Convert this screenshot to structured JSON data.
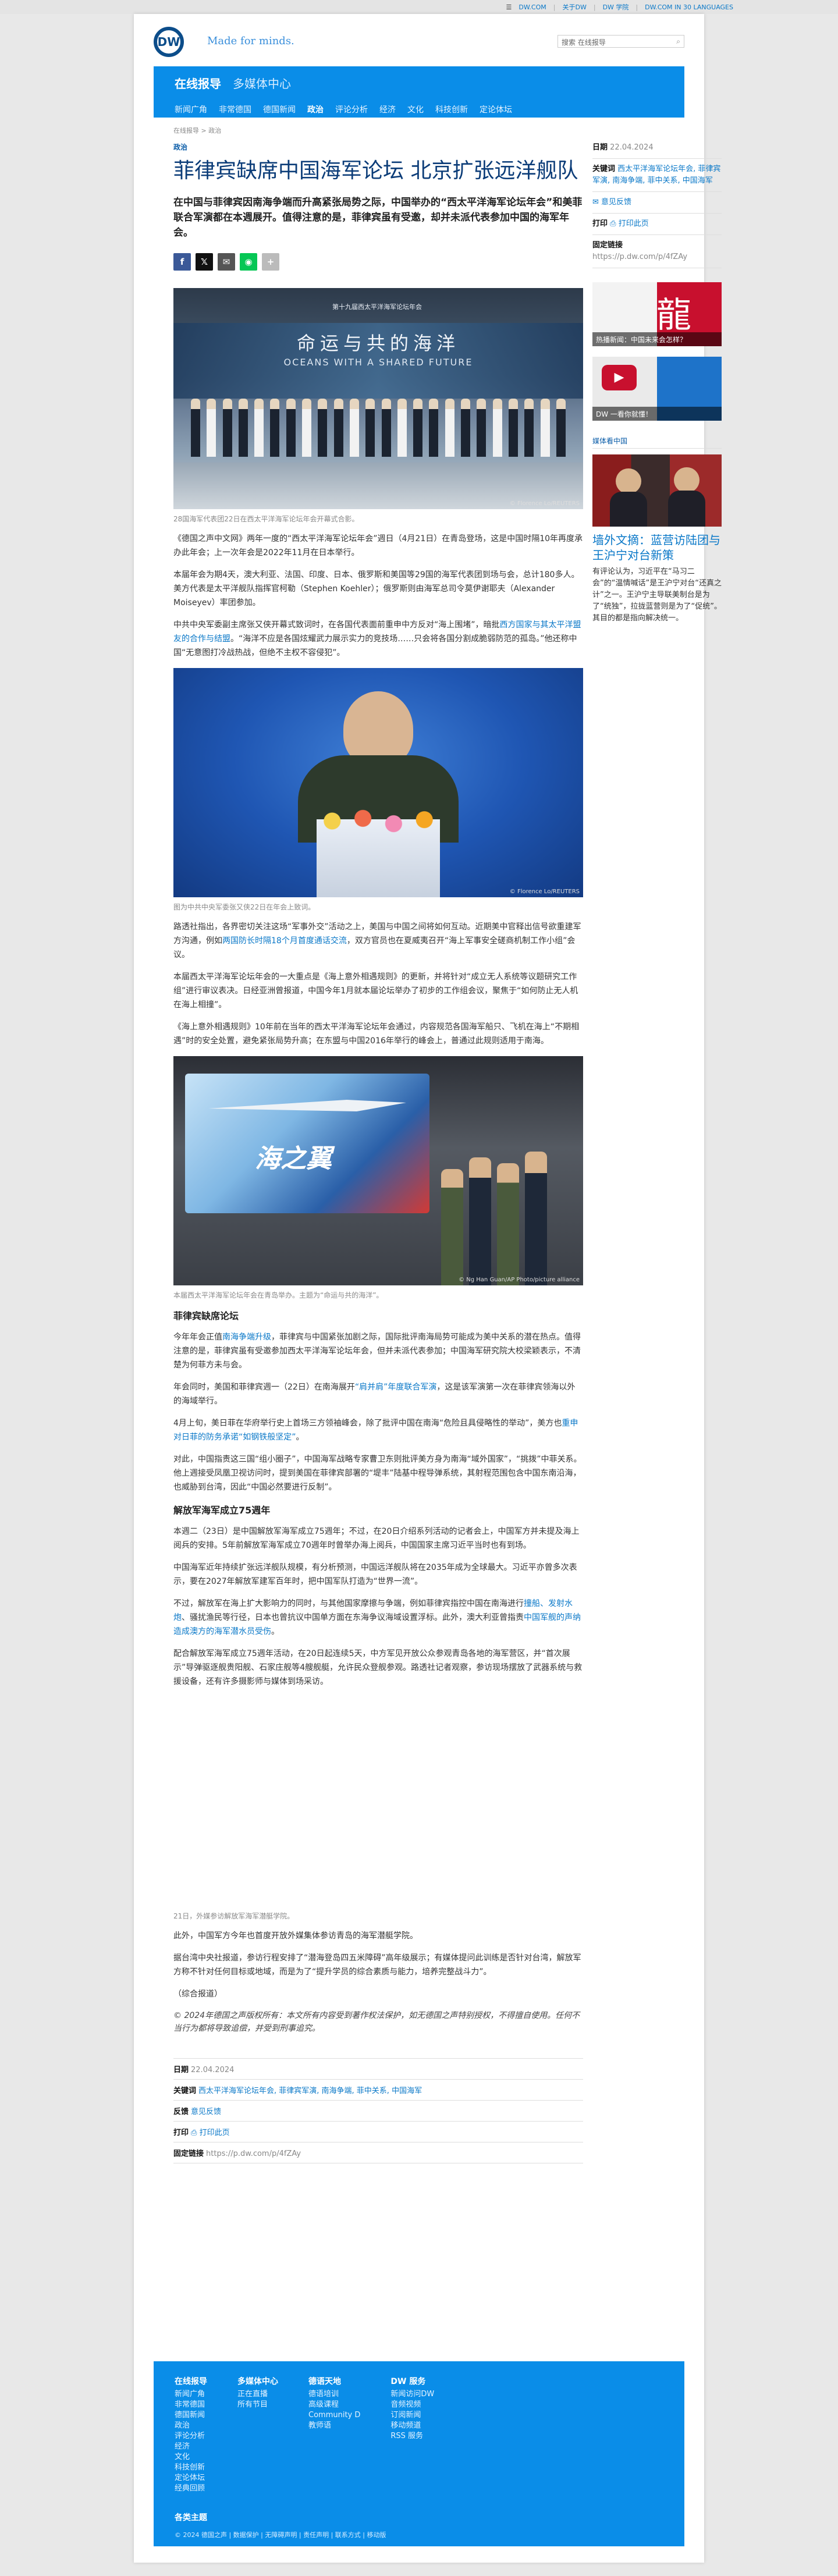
{
  "topbar": {
    "links": [
      "DW.COM",
      "关于DW",
      "DW 学院",
      "DW.COM IN 30 LANGUAGES"
    ]
  },
  "header": {
    "logo": "DW",
    "tagline": "Made for minds.",
    "search_placeholder": "搜索 在线报导"
  },
  "nav": {
    "title": "在线报导",
    "subtitle": "多媒体中心",
    "links": [
      "新闻广角",
      "非常德国",
      "德国新闻",
      "政治",
      "评论分析",
      "经济",
      "文化",
      "科技创新",
      "定论体坛"
    ],
    "active_index": 3
  },
  "breadcrumb": "在线报导 > 政治",
  "article": {
    "kicker": "政治",
    "title": "菲律宾缺席中国海军论坛 北京扩张远洋舰队",
    "lead": "在中国与菲律宾因南海争端而升高紧张局势之际，中国举办的“西太平洋海军论坛年会”和美菲联合军演都在本週展开。值得注意的是，菲律宾虽有受邀，却并未派代表参加中国的海军年会。",
    "share_icons": [
      "facebook-icon",
      "x-icon",
      "email-icon",
      "line-icon",
      "more-icon"
    ],
    "photo1_caption": "28国海军代表团22日在西太平洋海军论坛年会开幕式合影。",
    "photo1_banner_cn": "命运与共的海洋",
    "photo1_banner_en": "OCEANS WITH A SHARED FUTURE",
    "photo1_credit": "© Florence Lo/REUTERS",
    "p1": "《德国之声中文网》两年一度的“西太平洋海军论坛年会”週日（4月21日）在青岛登场，这是中国时隔10年再度承办此年会；上一次年会是2022年11月在日本举行。",
    "p2": "本届年会为期4天，澳大利亚、法国、印度、日本、俄罗斯和美国等29国的海军代表团到场与会，总计180多人。美方代表是太平洋舰队指挥官柯勒（Stephen Koehler）；俄罗斯则由海军总司令莫伊谢耶夫（Alexander Moiseyev）率团参加。",
    "p3_pre": "中共中央军委副主席张又侠开幕式致词时，在各国代表面前重申中方反对“海上围堵”，暗批",
    "p3_link": "西方国家与其太平洋盟友的合作与结盟",
    "p3_post": "。“海洋不应是各国炫耀武力展示实力的竞技场……只会将各国分割成脆弱防范的孤岛。”他还称中国“无意图打冷战热战，但绝不主权不容侵犯”。",
    "photo2_caption": "图为中共中央军委张又侠22日在年会上致词。",
    "photo2_credit": "© Florence Lo/REUTERS",
    "p4_pre": "路透社指出，各界密切关注这场“军事外交”活动之上，美国与中国之间将如何互动。近期美中官释出信号欲重建军方沟通，例如",
    "p4_link": "两国防长时隔18个月首度通话交流",
    "p4_post": "，双方官员也在夏威夷召开“海上军事安全磋商机制工作小组”会议。",
    "p5": "本届西太平洋海军论坛年会的一大重点是《海上意外相遇规则》的更新，并将针对“成立无人系统等议题研究工作组”进行审议表决。日经亚洲曾报道，中国今年1月就本届论坛举办了初步的工作组会议，聚焦于“如何防止无人机在海上相撞”。",
    "p6": "《海上意外相遇规则》10年前在当年的西太平洋海军论坛年会通过，内容规范各国海军船只、飞机在海上“不期相遇”时的安全处置，避免紧张局势升高；在东盟与中国2016年举行的峰会上，普通过此规则适用于南海。",
    "photo3_caption": "本届西太平洋海军论坛年会在青岛举办。主题为“命运与共的海洋”。",
    "photo3_banner": "海之翼",
    "photo3_credit": "© Ng Han Guan/AP Photo/picture alliance",
    "h_sub1": "菲律宾缺席论坛",
    "p7_pre": "今年年会正值",
    "p7_link": "南海争端升级",
    "p7_post": "，菲律宾与中国紧张加剧之际，国际批评南海局势可能成为美中关系的潜在热点。值得注意的是，菲律宾虽有受邀参加西太平洋海军论坛年会，但并未派代表参加；中国海军研究院大校梁颖表示，不清楚为何菲方未与会。",
    "p8_pre": "年会同时，美国和菲律宾週一（22日）在南海展开",
    "p8_link": "“肩并肩”年度联合军演",
    "p8_post": "，这是该军演第一次在菲律宾领海以外的海域举行。",
    "p9_pre": "4月上旬，美日菲在华府举行史上首场三方领袖峰会，除了批评中国在南海“危险且具侵略性的举动”，美方也",
    "p9_link": "重申对日菲的防务承诺“如钢铁般坚定”",
    "p9_post": "。",
    "p10": "对此，中国指责这三国“组小圈子”，中国海军战略专家曹卫东则批评美方身为南海“域外国家”，“挑拨”中菲关系。他上週接受凤凰卫视访问时，提到美国在菲律宾部署的“堤丰”陆基中程导弹系统，其射程范围包含中国东南沿海，也威胁到台湾，因此“中国必然要进行反制”。",
    "h_sub2": "解放军海军成立75週年",
    "p11": "本週二（23日）是中国解放军海军成立75週年；不过，在20日介绍系列活动的记者会上，中国军方并未提及海上阅兵的安排。5年前解放军海军成立70週年时曾举办海上阅兵，中国国家主席习近平当时也有到场。",
    "p12": "中国海军近年持续扩张远洋舰队规模，有分析预测，中国远洋舰队将在2035年成为全球最大。习近平亦曾多次表示，要在2027年解放军建军百年时，把中国军队打造为“世界一流”。",
    "p13_pre": "不过，解放军在海上扩大影响力的同时，与其他国家摩擦与争端，例如菲律宾指控中国在南海进行",
    "p13_link1": "撞船、发射水炮",
    "p13_mid": "、骚扰渔民等行径，日本也曾抗议中国单方面在东海争议海域设置浮标。此外，澳大利亚曾指责",
    "p13_link2": "中国军舰的声纳造成澳方的海军潜水员受伤",
    "p13_post": "。",
    "p14": "配合解放军海军成立75週年活动，在20日起连续5天，中方军见开放公众参观青岛各地的海军营区，并“首次展示”导弹驱逐舰贵阳舰、石家庄舰等4艘舰艇，允许民众登舰参观。路透社记者观察，参访现场摆放了武器系统与救援设备，还有许多摄影师与媒体到场采访。",
    "p15": "21日，外媒参访解放军海军潜艇学院。",
    "p16": "此外，中国军方今年也首度开放外媒集体参访青岛的海军潜艇学院。",
    "p17": "据台湾中央社报道，参访行程安排了“潜海登岛四五米障碍”高年级展示；有媒体提问此训练是否针对台湾，解放军方称不针对任何目标或地域，而是为了“提升学员的综合素质与能力，培养完整战斗力”。",
    "p18": "（综合报道）",
    "copyright": "© 2024年德国之声版权所有：本文所有内容受到著作权法保护，如无德国之声特别授权，不得擅自使用。任何不当行为都将导致追偿，并受到刑事追究。"
  },
  "meta": {
    "date_label": "日期",
    "date": "22.04.2024",
    "keywords_label": "关键词",
    "keywords": "西太平洋海军论坛年会, 菲律宾军演, 南海争端, 菲中关系, 中国海军",
    "feedback_label": "反馈",
    "feedback": "意见反馈",
    "print_label": "打印",
    "print": "打印此页",
    "link_label": "固定链接",
    "link": "https://p.dw.com/p/4fZAy"
  },
  "side": {
    "date_label": "日期",
    "date": "22.04.2024",
    "keywords_label": "关键词",
    "keywords": "西太平洋海军论坛年会, 菲律宾军演, 南海争端, 菲中关系, 中国海军",
    "feedback": "意见反馈",
    "print_label": "打印",
    "print": "打印此页",
    "link_label": "固定链接",
    "link": "https://p.dw.com/p/4fZAy",
    "ad1": "热播新闻：中国未来会怎样？",
    "ad2": "DW 一看你就懂！",
    "section": "媒体看中国",
    "teaser_title": "墙外文摘：蓝营访陆团与王沪宁对台新策",
    "teaser_text": "有评论认为，习近平在“马习二会”的“温情喊话”是王沪宁对台“还真之计”之一。王沪宁主导联美制台是为了“统独”，拉拢蓝营则是为了“促统”。其目的都是指向解决统一。"
  },
  "footer": {
    "columns": [
      {
        "title": "在线报导",
        "items": [
          "新闻广角",
          "非常德国",
          "德国新闻",
          "政治",
          "评论分析",
          "经济",
          "文化",
          "科技创新",
          "定论体坛",
          "经典回顾"
        ]
      },
      {
        "title": "多媒体中心",
        "items": [
          "正在直播",
          "所有节目"
        ]
      },
      {
        "title": "德语天地",
        "items": [
          "德语培训",
          "高级课程",
          "Community D",
          "教师语"
        ]
      },
      {
        "title": "DW 服务",
        "items": [
          "新闻访问DW",
          "音频视频",
          "订阅新闻",
          "移动频道",
          "RSS 服务"
        ]
      }
    ],
    "theme": "各类主题",
    "legal": "© 2024 德国之声 | 数据保护 | 无障碍声明 | 责任声明 | 联系方式 | 移动版"
  },
  "colors": {
    "brand": "#0a8de8",
    "title": "#0b3c78",
    "link": "#0a78c8"
  }
}
